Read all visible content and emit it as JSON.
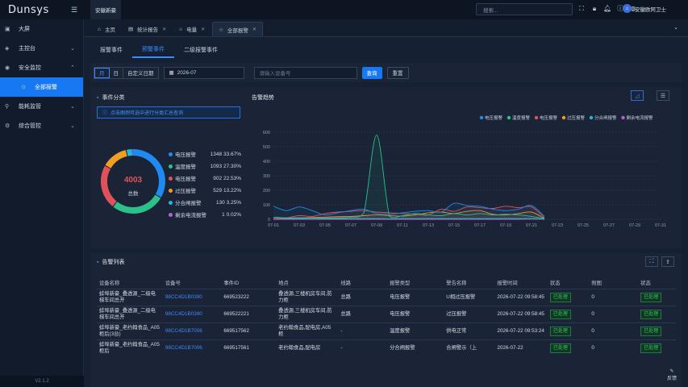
{
  "app": {
    "logo": "Dunsys",
    "module_tab": "安徽新豪"
  },
  "header": {
    "search_placeholder": "搜索...",
    "user_name": "安徽欧阿卫士",
    "icons": [
      "fullscreen-icon",
      "lock-icon",
      "bell-icon",
      "info-icon",
      "globe-icon"
    ]
  },
  "sidebar": {
    "items": [
      {
        "label": "大屏",
        "icon": "screen-icon"
      },
      {
        "label": "主控台",
        "icon": "dashboard-icon",
        "arrow": "⌄"
      },
      {
        "label": "安全监控",
        "icon": "shield-icon",
        "arrow": "⌃"
      },
      {
        "label": "全部报警",
        "icon": "alarm-icon",
        "active": true
      },
      {
        "label": "能耗监管",
        "icon": "energy-icon",
        "arrow": "⌄"
      },
      {
        "label": "综合管控",
        "icon": "control-icon",
        "arrow": "⌄"
      }
    ],
    "version": "V2.1.2"
  },
  "tabs": [
    {
      "label": "主页"
    },
    {
      "label": "统计报告"
    },
    {
      "label": "电量"
    },
    {
      "label": "全部报警",
      "active": true
    }
  ],
  "subtabs": [
    "报警事件",
    "预警事件",
    "二级报警事件"
  ],
  "filters": {
    "segments": [
      "月",
      "日",
      "自定义日期"
    ],
    "date_value": "2026-07",
    "device_placeholder": "请输入设备号",
    "query_label": "查询",
    "reset_label": "重置"
  },
  "event_panel": {
    "title": "事件分类",
    "notice": "点击图例可选中进行分类汇总查询",
    "total_value": "4003",
    "total_label": "总数",
    "legend": [
      {
        "name": "电压报警",
        "value": "1348",
        "percent": "33.67%",
        "color": "#1f8af0"
      },
      {
        "name": "温度报警",
        "value": "1093",
        "percent": "27.30%",
        "color": "#2bc28a"
      },
      {
        "name": "电压报警",
        "value": "902",
        "percent": "22.53%",
        "color": "#e0525a"
      },
      {
        "name": "过压报警",
        "value": "529",
        "percent": "13.22%",
        "color": "#f0a020"
      },
      {
        "name": "分合闸报警",
        "value": "130",
        "percent": "3.25%",
        "color": "#21b7d8"
      },
      {
        "name": "剩余电流报警",
        "value": "1",
        "percent": "0.02%",
        "color": "#b960d8"
      }
    ]
  },
  "trend_panel": {
    "title": "告警趋势"
  },
  "list_panel": {
    "title": "告警列表",
    "columns": [
      "设备名称",
      "设备号",
      "事件ID",
      "地点",
      "线路",
      "报警类型",
      "警告名称",
      "报警时间",
      "状态",
      "附图",
      "状态"
    ],
    "rows": [
      {
        "name": "蚌埠新豪_叠透源_二级电梯车间总开",
        "device": "98CC4D1B0390",
        "event_id": "669523222",
        "place": "叠透源,三楼机房车间,防力柜",
        "line": "总路",
        "type": "电压报警",
        "warn": "U相过压报警",
        "time": "2026-07-22 09:58:45",
        "status": "已处理",
        "img": "0",
        "status2": "已处理"
      },
      {
        "name": "蚌埠新豪_叠透源_二级电梯车间总开",
        "device": "98CC4D1B0390",
        "event_id": "669522221",
        "place": "叠透源,三楼机房车间,防力柜",
        "line": "总路",
        "type": "电压报警",
        "warn": "过压报警",
        "time": "2026-07-22 09:58:45",
        "status": "已处理",
        "img": "0",
        "status2": "已处理"
      },
      {
        "name": "蚌埠新豪_老约翰食品_A05柜后(3台)",
        "device": "98CC4D1B7006",
        "event_id": "669517562",
        "place": "老约翰食品,配电房,A05柜",
        "line": "-",
        "type": "温度报警",
        "warn": "供电正常",
        "time": "2026-07-22 09:53:24",
        "status": "已处理",
        "img": "0",
        "status2": "已处理"
      },
      {
        "name": "蚌埠新豪_老约翰食品_A05柜后",
        "device": "98CC4D1B7006",
        "event_id": "669517561",
        "place": "老约翰食品,配电房",
        "line": "-",
        "type": "分合闸报警",
        "warn": "合闸警示（上",
        "time": "2026-07-22",
        "status": "已处理",
        "img": "0",
        "status2": "已处理"
      }
    ]
  },
  "feedback_label": "反馈",
  "chart_data": {
    "type": "line",
    "title": "告警趋势",
    "x": [
      "07-01",
      "07-02",
      "07-03",
      "07-04",
      "07-05",
      "07-06",
      "07-07",
      "07-08",
      "07-09",
      "07-10",
      "07-11",
      "07-12",
      "07-13",
      "07-14",
      "07-15",
      "07-16",
      "07-17",
      "07-18",
      "07-19",
      "07-20",
      "07-21",
      "07-22",
      "07-23",
      "07-24",
      "07-25",
      "07-26",
      "07-27",
      "07-28",
      "07-29",
      "07-30",
      "07-31"
    ],
    "x_tick_labels": [
      "07-01",
      "07-03",
      "07-05",
      "07-07",
      "07-09",
      "07-11",
      "07-13",
      "07-15",
      "07-17",
      "07-19",
      "07-21",
      "07-23",
      "07-25",
      "07-27",
      "07-29",
      "07-31"
    ],
    "ylim": [
      0,
      600
    ],
    "y_ticks": [
      0,
      100,
      200,
      300,
      400,
      500,
      600
    ],
    "legend_position": "top-right",
    "grid": true,
    "series": [
      {
        "name": "电压报警",
        "color": "#1f8af0",
        "values": [
          90,
          60,
          85,
          60,
          30,
          45,
          60,
          70,
          40,
          35,
          45,
          55,
          60,
          50,
          110,
          95,
          90,
          70,
          60,
          70,
          95,
          20,
          null,
          null,
          null,
          null,
          null,
          null,
          null,
          null,
          null
        ]
      },
      {
        "name": "温度报警",
        "color": "#2bc28a",
        "values": [
          15,
          10,
          10,
          8,
          8,
          10,
          15,
          45,
          580,
          20,
          25,
          40,
          30,
          25,
          40,
          30,
          40,
          30,
          35,
          30,
          20,
          5,
          null,
          null,
          null,
          null,
          null,
          null,
          null,
          null,
          null
        ]
      },
      {
        "name": "电压报警",
        "color": "#e0525a",
        "values": [
          5,
          10,
          25,
          20,
          40,
          50,
          55,
          60,
          50,
          45,
          40,
          35,
          30,
          70,
          55,
          85,
          80,
          75,
          90,
          80,
          85,
          10,
          null,
          null,
          null,
          null,
          null,
          null,
          null,
          null,
          null
        ]
      },
      {
        "name": "过压报警",
        "color": "#f0a020",
        "values": [
          5,
          8,
          10,
          12,
          15,
          18,
          20,
          25,
          30,
          25,
          22,
          30,
          45,
          50,
          40,
          55,
          60,
          35,
          30,
          40,
          50,
          5,
          null,
          null,
          null,
          null,
          null,
          null,
          null,
          null,
          null
        ]
      },
      {
        "name": "分合闸报警",
        "color": "#21b7d8",
        "values": [
          5,
          5,
          5,
          6,
          5,
          5,
          6,
          5,
          5,
          4,
          5,
          5,
          6,
          5,
          5,
          6,
          5,
          5,
          6,
          5,
          5,
          2,
          null,
          null,
          null,
          null,
          null,
          null,
          null,
          null,
          null
        ]
      },
      {
        "name": "剩余电流报警",
        "color": "#b960d8",
        "values": [
          0,
          0,
          0,
          0,
          0,
          0,
          0,
          0,
          0,
          0,
          0,
          0,
          0,
          0,
          0,
          0,
          0,
          0,
          0,
          0,
          1,
          0,
          null,
          null,
          null,
          null,
          null,
          null,
          null,
          null,
          null
        ]
      }
    ],
    "donut": {
      "total": 4003,
      "values": [
        1348,
        1093,
        902,
        529,
        130,
        1
      ]
    }
  }
}
